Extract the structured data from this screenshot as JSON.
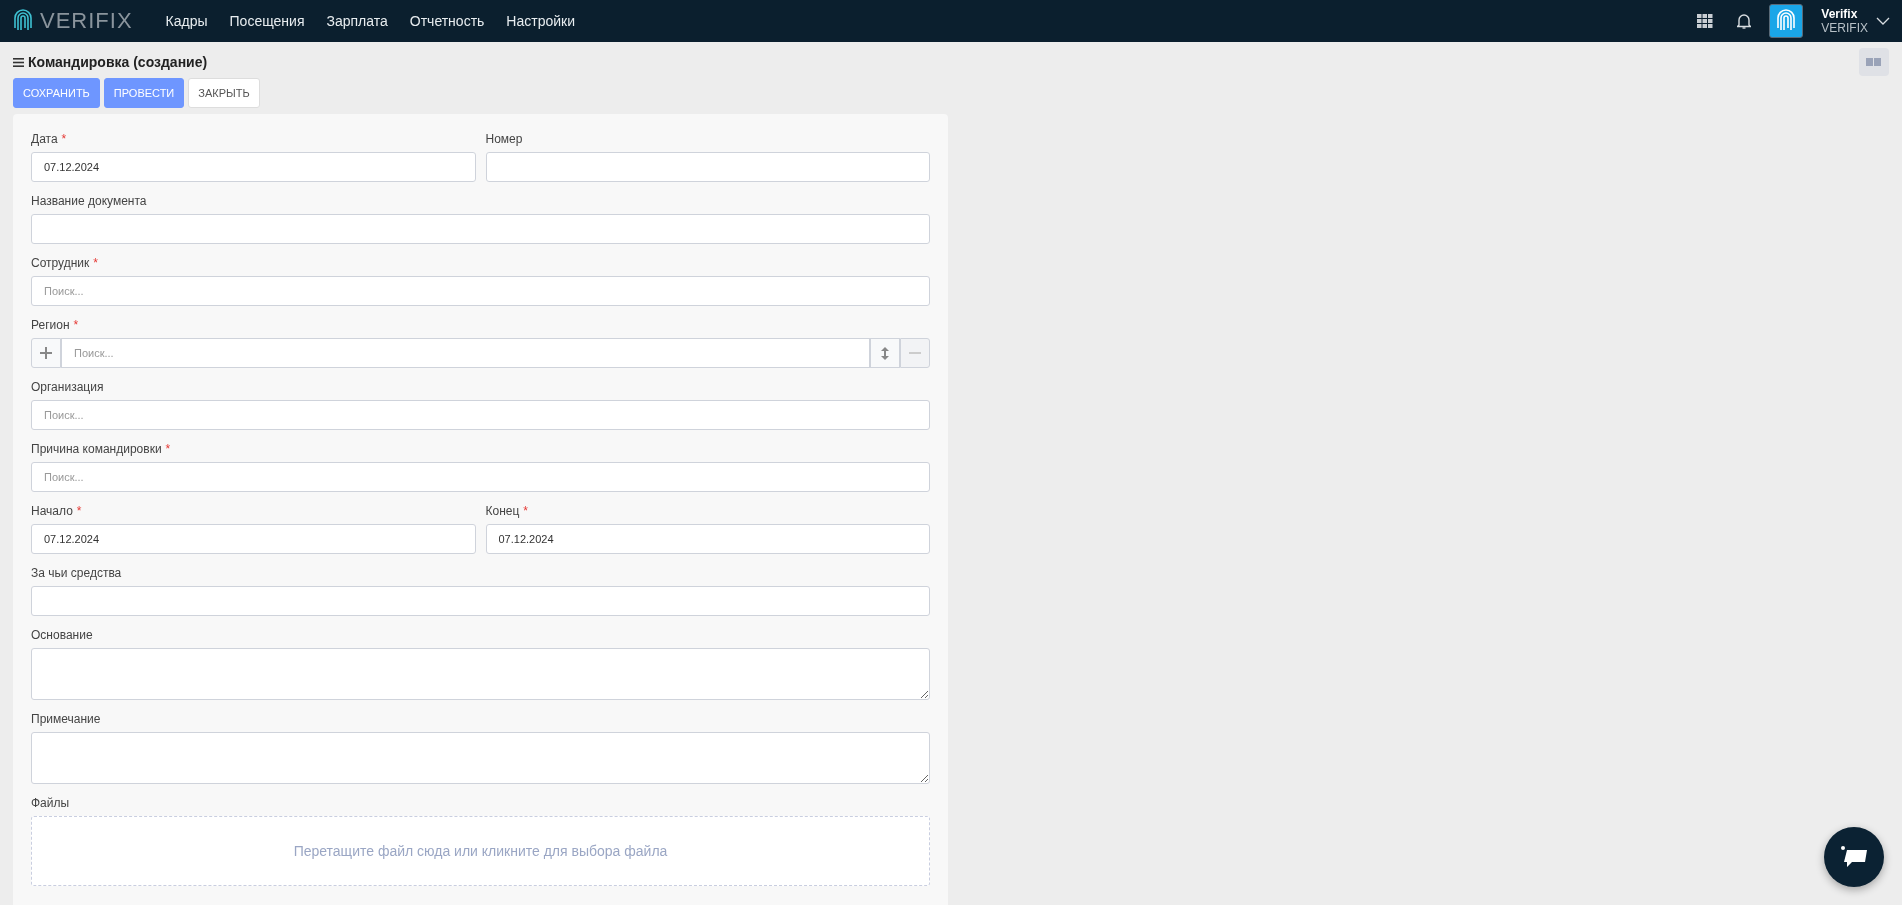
{
  "header": {
    "logo": "VERIFIX",
    "nav": [
      {
        "label": "Кадры"
      },
      {
        "label": "Посещения"
      },
      {
        "label": "Зарплата"
      },
      {
        "label": "Отчетность"
      },
      {
        "label": "Настройки"
      }
    ],
    "user": {
      "name": "Verifix",
      "company": "VERIFIX"
    }
  },
  "page": {
    "title": "Командировка (создание)",
    "buttons": [
      {
        "label": "СОХРАНИТЬ",
        "kind": "primary"
      },
      {
        "label": "ПРОВЕСТИ",
        "kind": "primary"
      },
      {
        "label": "ЗАКРЫТЬ",
        "kind": "default"
      }
    ]
  },
  "form": {
    "rows": [
      [
        {
          "label": "Дата",
          "required_mark": "*",
          "kind": "input",
          "value": "07.12.2024"
        },
        {
          "label": "Номер",
          "kind": "input"
        }
      ],
      [
        {
          "label": "Название документа",
          "kind": "input"
        }
      ],
      [
        {
          "label": "Сотрудник",
          "required_mark": "*",
          "kind": "input",
          "placeholder": "Поиск..."
        }
      ],
      [
        {
          "label": "Регион",
          "required_mark": "*",
          "kind": "tree",
          "placeholder": "Поиск..."
        }
      ],
      [
        {
          "label": "Организация",
          "kind": "input",
          "placeholder": "Поиск..."
        }
      ],
      [
        {
          "label": "Причина командировки",
          "required_mark": "*",
          "kind": "input",
          "placeholder": "Поиск..."
        }
      ],
      [
        {
          "label": "Начало",
          "required_mark": "*",
          "kind": "input",
          "value": "07.12.2024"
        },
        {
          "label": "Конец",
          "required_mark": "*",
          "kind": "input",
          "value": "07.12.2024"
        }
      ],
      [
        {
          "label": "За чьи средства",
          "kind": "input"
        }
      ],
      [
        {
          "label": "Основание",
          "kind": "textarea"
        }
      ],
      [
        {
          "label": "Примечание",
          "kind": "textarea"
        }
      ],
      [
        {
          "label": "Файлы",
          "kind": "dropzone",
          "placeholder": "Перетащите файл сюда или кликните для выбора файла"
        }
      ]
    ]
  }
}
